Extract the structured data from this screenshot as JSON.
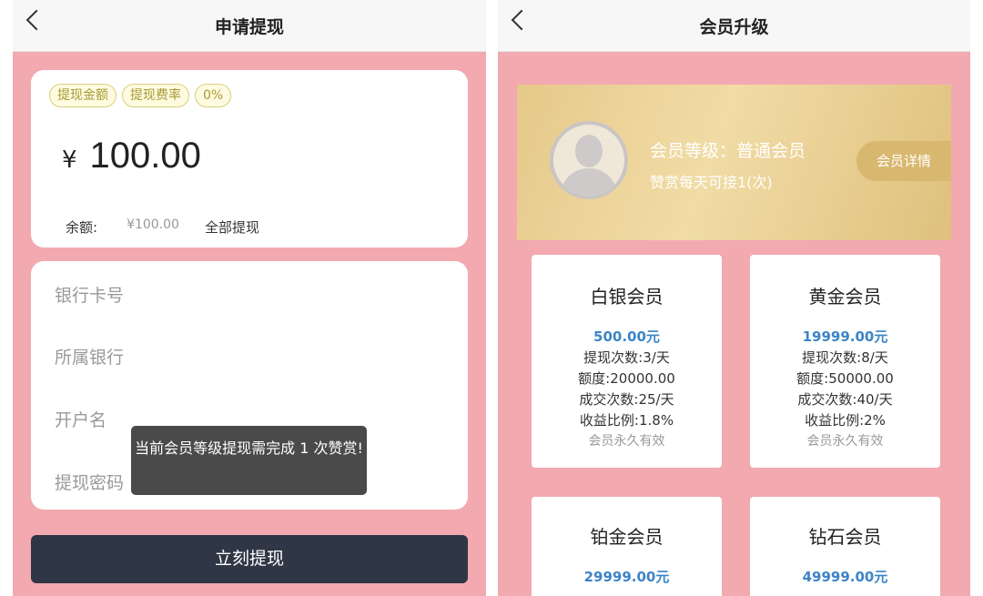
{
  "withdraw": {
    "title": "申请提现",
    "tags": [
      "提现金额",
      "提现费率",
      "0%"
    ],
    "currency": "¥",
    "amount": "100.00",
    "balance_label": "余额:",
    "balance_value": "¥100.00",
    "withdraw_all": "全部提现",
    "fields": [
      "银行卡号",
      "所属银行",
      "开户名",
      "提现密码"
    ],
    "toast": "当前会员等级提现需完成 1 次赞赏!",
    "submit": "立刻提现"
  },
  "upgrade": {
    "title": "会员升级",
    "level": "会员等级：普通会员",
    "daily_quota": "赞赏每天可接1(次)",
    "detail_button": "会员详情",
    "tiers": [
      {
        "name": "白银会员",
        "price": "500.00元",
        "withdraw_times": "提现次数:3/天",
        "limit": "额度:20000.00",
        "deal_times": "成交次数:25/天",
        "ratio": "收益比例:1.8%",
        "validity": "会员永久有效"
      },
      {
        "name": "黄金会员",
        "price": "19999.00元",
        "withdraw_times": "提现次数:8/天",
        "limit": "额度:50000.00",
        "deal_times": "成交次数:40/天",
        "ratio": "收益比例:2%",
        "validity": "会员永久有效"
      },
      {
        "name": "铂金会员",
        "price": "29999.00元"
      },
      {
        "name": "钻石会员",
        "price": "49999.00元"
      }
    ]
  },
  "colors": {
    "background_pink": "#f2a9b0",
    "submit_dark": "#2f3645",
    "price_blue": "#3d84c6",
    "banner_gold": "#e6c98a"
  },
  "icons": [
    "back-arrow-icon",
    "avatar-icon"
  ]
}
